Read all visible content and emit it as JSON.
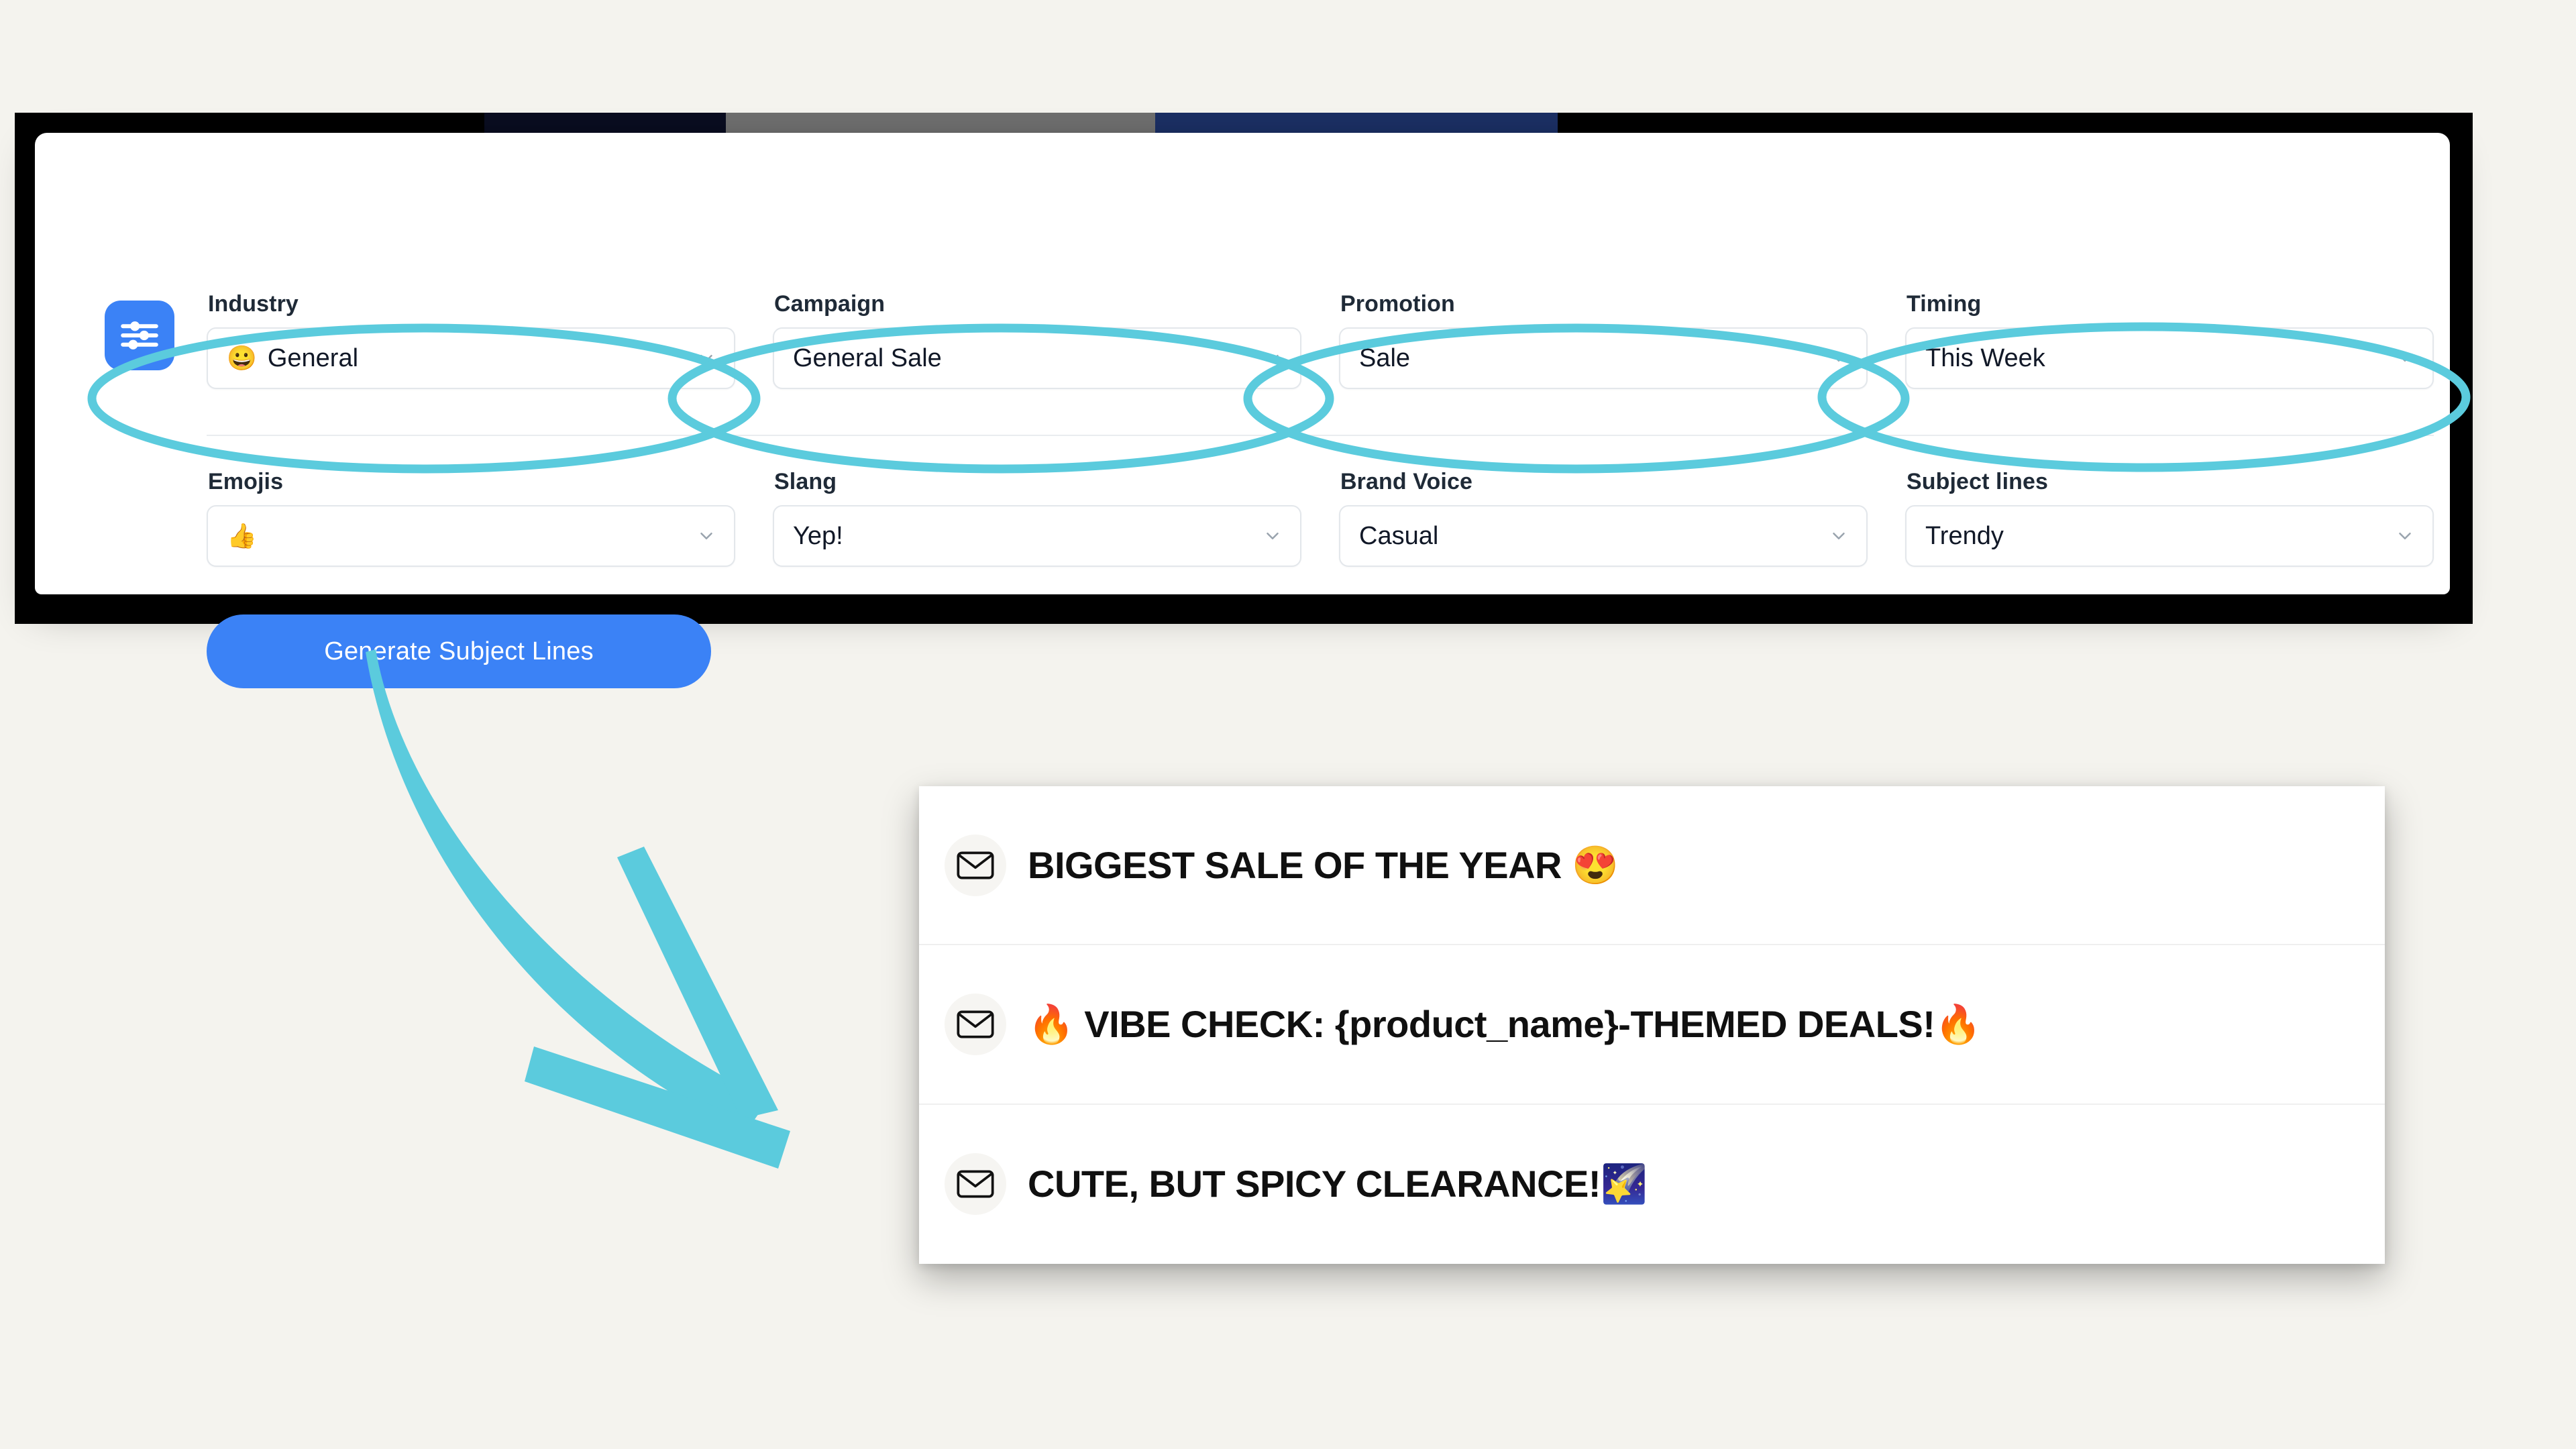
{
  "app": {
    "icon": "sliders-icon",
    "accent_color": "#3b82f6",
    "annotation_color": "#5bcbdd",
    "background_color": "#f4f3ee"
  },
  "form": {
    "row1": [
      {
        "label": "Industry",
        "value": "General",
        "lead_emoji": "😀",
        "control": "dropdown",
        "name": "industry"
      },
      {
        "label": "Campaign",
        "value": "General Sale",
        "lead_emoji": "",
        "control": "dropdown",
        "name": "campaign"
      },
      {
        "label": "Promotion",
        "value": "Sale",
        "lead_emoji": "",
        "control": "dropdown",
        "name": "promotion"
      },
      {
        "label": "Timing",
        "value": "This Week",
        "lead_emoji": "",
        "control": "dropdown",
        "name": "timing"
      }
    ],
    "row2": [
      {
        "label": "Emojis",
        "value": "",
        "lead_emoji": "👍",
        "control": "dropdown",
        "name": "emojis"
      },
      {
        "label": "Slang",
        "value": "Yep!",
        "lead_emoji": "",
        "control": "dropdown",
        "name": "slang"
      },
      {
        "label": "Brand Voice",
        "value": "Casual",
        "lead_emoji": "",
        "control": "dropdown",
        "name": "brand-voice"
      },
      {
        "label": "Subject lines",
        "value": "Trendy",
        "lead_emoji": "",
        "control": "dropdown",
        "name": "subject-lines"
      }
    ],
    "generate_button_label": "Generate Subject Lines"
  },
  "results": {
    "items": [
      {
        "icon": "envelope-icon",
        "text": "BIGGEST SALE OF THE YEAR 😍"
      },
      {
        "icon": "envelope-icon",
        "text": "🔥 VIBE CHECK: {product_name}-THEMED DEALS!🔥"
      },
      {
        "icon": "envelope-icon",
        "text": "CUTE, BUT SPICY CLEARANCE!🌠"
      }
    ]
  },
  "annotations": {
    "ellipse_count": 4,
    "arrow": "curved-down-right-arrow"
  }
}
